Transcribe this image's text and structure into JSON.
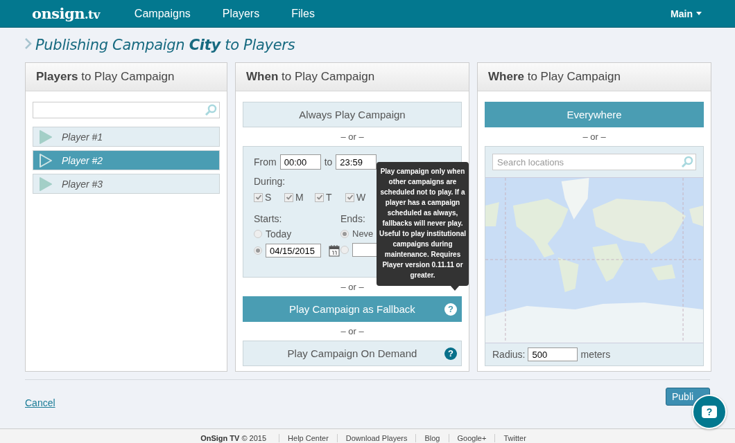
{
  "nav": {
    "logo": {
      "main": "onsign",
      "dot": ".",
      "suffix": "tv"
    },
    "links": [
      "Campaigns",
      "Players",
      "Files"
    ],
    "account": "Main"
  },
  "title": "Publishing Campaign **City** to Players",
  "players_panel": {
    "heading_bold": "Players",
    "heading_rest": "to Play Campaign",
    "players": [
      {
        "name": "Player #1",
        "selected": false
      },
      {
        "name": "Player #2",
        "selected": true
      },
      {
        "name": "Player #3",
        "selected": false
      }
    ]
  },
  "when_panel": {
    "heading_bold": "When",
    "heading_rest": "to Play Campaign",
    "always": {
      "label": "Always Play Campaign",
      "selected": false
    },
    "separators": [
      "– or –",
      "– or –",
      "– or –"
    ],
    "schedule": {
      "from_label": "From",
      "from": "00:00",
      "to_label": "to",
      "to": "23:59",
      "during_label": "During:",
      "days": [
        {
          "label": "S",
          "checked": true
        },
        {
          "label": "M",
          "checked": true
        },
        {
          "label": "T",
          "checked": true
        },
        {
          "label": "W",
          "checked": true
        }
      ],
      "starts_label": "Starts:",
      "starts_today": {
        "label": "Today",
        "selected": false
      },
      "starts_date": {
        "value": "04/15/2015",
        "selected": true
      },
      "ends_label": "Ends:",
      "ends_never": {
        "label": "Neve",
        "selected": true
      },
      "ends_date": {
        "selected": false
      }
    },
    "fallback": {
      "label": "Play Campaign as Fallback",
      "help": "?",
      "selected": true
    },
    "on_demand": {
      "label": "Play Campaign On Demand",
      "help": "?",
      "selected": false
    },
    "tooltip": "Play campaign only when other campaigns are scheduled not to play. If a player has a campaign scheduled as always, fallbacks will never play. Useful to play institutional campaigns during maintenance. Requires Player version 0.11.11 or greater."
  },
  "where_panel": {
    "heading_bold": "Where",
    "heading_rest": "to Play Campaign",
    "everywhere": {
      "label": "Everywhere",
      "selected": true
    },
    "separator": "– or –",
    "search": {
      "placeholder": "Search locations"
    },
    "radius_label": "Radius:",
    "radius": "500",
    "radius_unit": "meters"
  },
  "actions": {
    "cancel": "Cancel",
    "publish": "Publi",
    "help": "?"
  },
  "footer": {
    "brand": "OnSign TV",
    "copyright": "© 2015",
    "links": [
      "Help Center",
      "Download Players",
      "Blog",
      "Google+",
      "Twitter"
    ]
  }
}
